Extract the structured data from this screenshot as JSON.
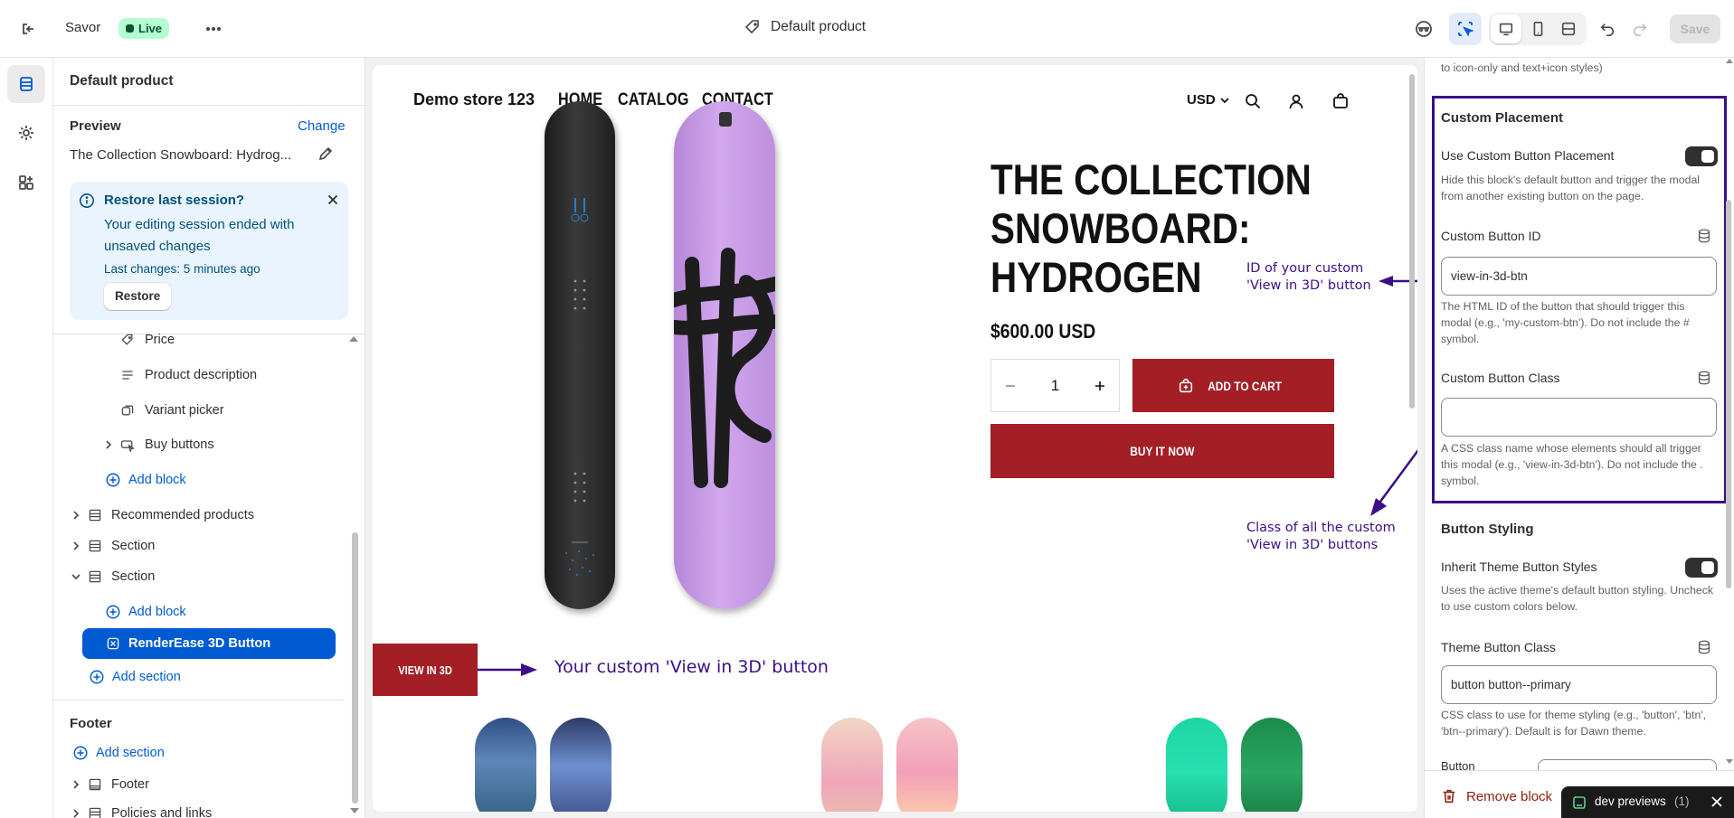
{
  "topbar": {
    "store_name": "Savor",
    "live_badge": "Live",
    "template_name": "Default product",
    "save_label": "Save"
  },
  "left_panel": {
    "title": "Default product",
    "preview_label": "Preview",
    "change_link": "Change",
    "preview_product": "The Collection Snowboard: Hydrog...",
    "restore": {
      "title": "Restore last session?",
      "message": "Your editing session ended with unsaved changes",
      "last_changes": "Last changes: 5 minutes ago",
      "button": "Restore"
    },
    "tree": {
      "price": "Price",
      "product_description": "Product description",
      "variant_picker": "Variant picker",
      "buy_buttons": "Buy buttons",
      "add_block_1": "Add block",
      "recommended_products": "Recommended products",
      "section_1": "Section",
      "section_2": "Section",
      "add_block_2": "Add block",
      "renderease": "RenderEase 3D Button",
      "add_section_1": "Add section"
    },
    "footer": {
      "heading": "Footer",
      "add_section": "Add section",
      "footer_item": "Footer",
      "policies": "Policies and links"
    }
  },
  "preview": {
    "store_name": "Demo store 123",
    "nav": [
      "HOME",
      "CATALOG",
      "CONTACT"
    ],
    "currency": "USD",
    "product_title_lines": [
      "THE COLLECTION",
      "SNOWBOARD:",
      "HYDROGEN"
    ],
    "price": "$600.00 USD",
    "quantity": "1",
    "add_to_cart": "ADD TO CART",
    "buy_it_now": "BUY IT NOW",
    "view_in_3d": "VIEW IN 3D",
    "annotations": {
      "id_note_1": "ID of your custom",
      "id_note_2": "'View in 3D' button",
      "class_note_1": "Class of all the custom",
      "class_note_2": "'View in 3D' buttons",
      "custom_button_note": "Your custom 'View in 3D' button"
    }
  },
  "right_panel": {
    "top_help": "to icon-only and text+icon styles)",
    "custom_placement_heading": "Custom Placement",
    "use_custom_label": "Use Custom Button Placement",
    "use_custom_help": "Hide this block's default button and trigger the modal from another existing button on the page.",
    "custom_id_label": "Custom Button ID",
    "custom_id_value": "view-in-3d-btn",
    "custom_id_help": "The HTML ID of the button that should trigger this modal (e.g., 'my-custom-btn'). Do not include the # symbol.",
    "custom_class_label": "Custom Button Class",
    "custom_class_value": "",
    "custom_class_help": "A CSS class name whose elements should all trigger this modal (e.g., 'view-in-3d-btn'). Do not include the . symbol.",
    "button_styling_heading": "Button Styling",
    "inherit_label": "Inherit Theme Button Styles",
    "inherit_help": "Uses the active theme's default button styling. Uncheck to use custom colors below.",
    "theme_class_label": "Theme Button Class",
    "theme_class_value": "button button--primary",
    "theme_class_help": "CSS class to use for theme styling (e.g., 'button', 'btn', 'btn--primary'). Default is for Dawn theme.",
    "button_label": "Button",
    "remove_block": "Remove block"
  },
  "dev_toast": {
    "label": "dev previews",
    "count": "(1)"
  },
  "colors": {
    "accent_blue": "#005bd3",
    "brand_red": "#a31f25",
    "annotation_purple": "#3b0f86",
    "live_green": "#b4fed2",
    "snowboard_purple": "#c79ce6"
  }
}
